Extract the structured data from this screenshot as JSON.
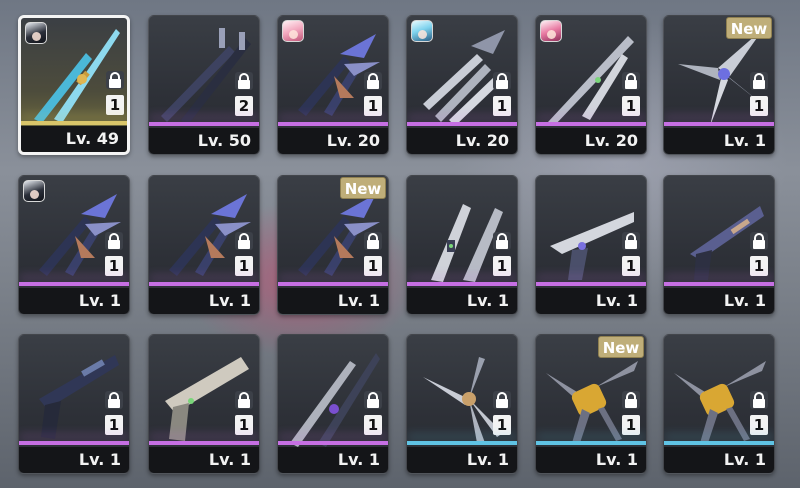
{
  "colors": {
    "purple": "#c66fe3",
    "blue": "#5fc3e4",
    "gold": "#d9c56a"
  },
  "items": [
    {
      "level": "Lv. 49",
      "qty": "1",
      "avatar": "dark",
      "new": false,
      "bar": "gold",
      "icon": "sword-pair-weapon-icon",
      "selected": true
    },
    {
      "level": "Lv. 50",
      "qty": "2",
      "avatar": "",
      "new": false,
      "bar": "purple",
      "icon": "dual-pole-weapon-icon",
      "selected": false
    },
    {
      "level": "Lv. 20",
      "qty": "1",
      "avatar": "pink",
      "new": false,
      "bar": "purple",
      "icon": "winged-blade-weapon-icon",
      "selected": false
    },
    {
      "level": "Lv. 20",
      "qty": "1",
      "avatar": "cyan",
      "new": false,
      "bar": "purple",
      "icon": "claw-blade-weapon-icon",
      "selected": false
    },
    {
      "level": "Lv. 20",
      "qty": "1",
      "avatar": "rose",
      "new": false,
      "bar": "purple",
      "icon": "spear-weapon-icon",
      "selected": false
    },
    {
      "level": "Lv. 1",
      "qty": "1",
      "avatar": "",
      "new": true,
      "bar": "purple",
      "icon": "star-blade-weapon-icon",
      "selected": false
    },
    {
      "level": "Lv. 1",
      "qty": "1",
      "avatar": "dark",
      "new": false,
      "bar": "purple",
      "icon": "winged-blade-weapon-icon",
      "selected": false
    },
    {
      "level": "Lv. 1",
      "qty": "1",
      "avatar": "",
      "new": false,
      "bar": "purple",
      "icon": "winged-blade-weapon-icon",
      "selected": false
    },
    {
      "level": "Lv. 1",
      "qty": "1",
      "avatar": "",
      "new": true,
      "bar": "purple",
      "icon": "winged-blade-weapon-icon",
      "selected": false
    },
    {
      "level": "Lv. 1",
      "qty": "1",
      "avatar": "",
      "new": false,
      "bar": "purple",
      "icon": "twin-blade-weapon-icon",
      "selected": false
    },
    {
      "level": "Lv. 1",
      "qty": "1",
      "avatar": "",
      "new": false,
      "bar": "purple",
      "icon": "blaster-weapon-icon",
      "selected": false
    },
    {
      "level": "Lv. 1",
      "qty": "1",
      "avatar": "",
      "new": false,
      "bar": "purple",
      "icon": "pistol-weapon-icon",
      "selected": false
    },
    {
      "level": "Lv. 1",
      "qty": "1",
      "avatar": "",
      "new": false,
      "bar": "purple",
      "icon": "revolver-weapon-icon",
      "selected": false
    },
    {
      "level": "Lv. 1",
      "qty": "1",
      "avatar": "",
      "new": false,
      "bar": "purple",
      "icon": "heavy-pistol-weapon-icon",
      "selected": false
    },
    {
      "level": "Lv. 1",
      "qty": "1",
      "avatar": "",
      "new": false,
      "bar": "purple",
      "icon": "scythe-pair-weapon-icon",
      "selected": false
    },
    {
      "level": "Lv. 1",
      "qty": "1",
      "avatar": "",
      "new": false,
      "bar": "blue",
      "icon": "talon-weapon-icon",
      "selected": false
    },
    {
      "level": "Lv. 1",
      "qty": "1",
      "avatar": "",
      "new": true,
      "bar": "blue",
      "icon": "gold-gauntlet-weapon-icon",
      "selected": false
    },
    {
      "level": "Lv. 1",
      "qty": "1",
      "avatar": "",
      "new": false,
      "bar": "blue",
      "icon": "gold-gauntlet-weapon-icon",
      "selected": false
    }
  ],
  "new_label": "New"
}
